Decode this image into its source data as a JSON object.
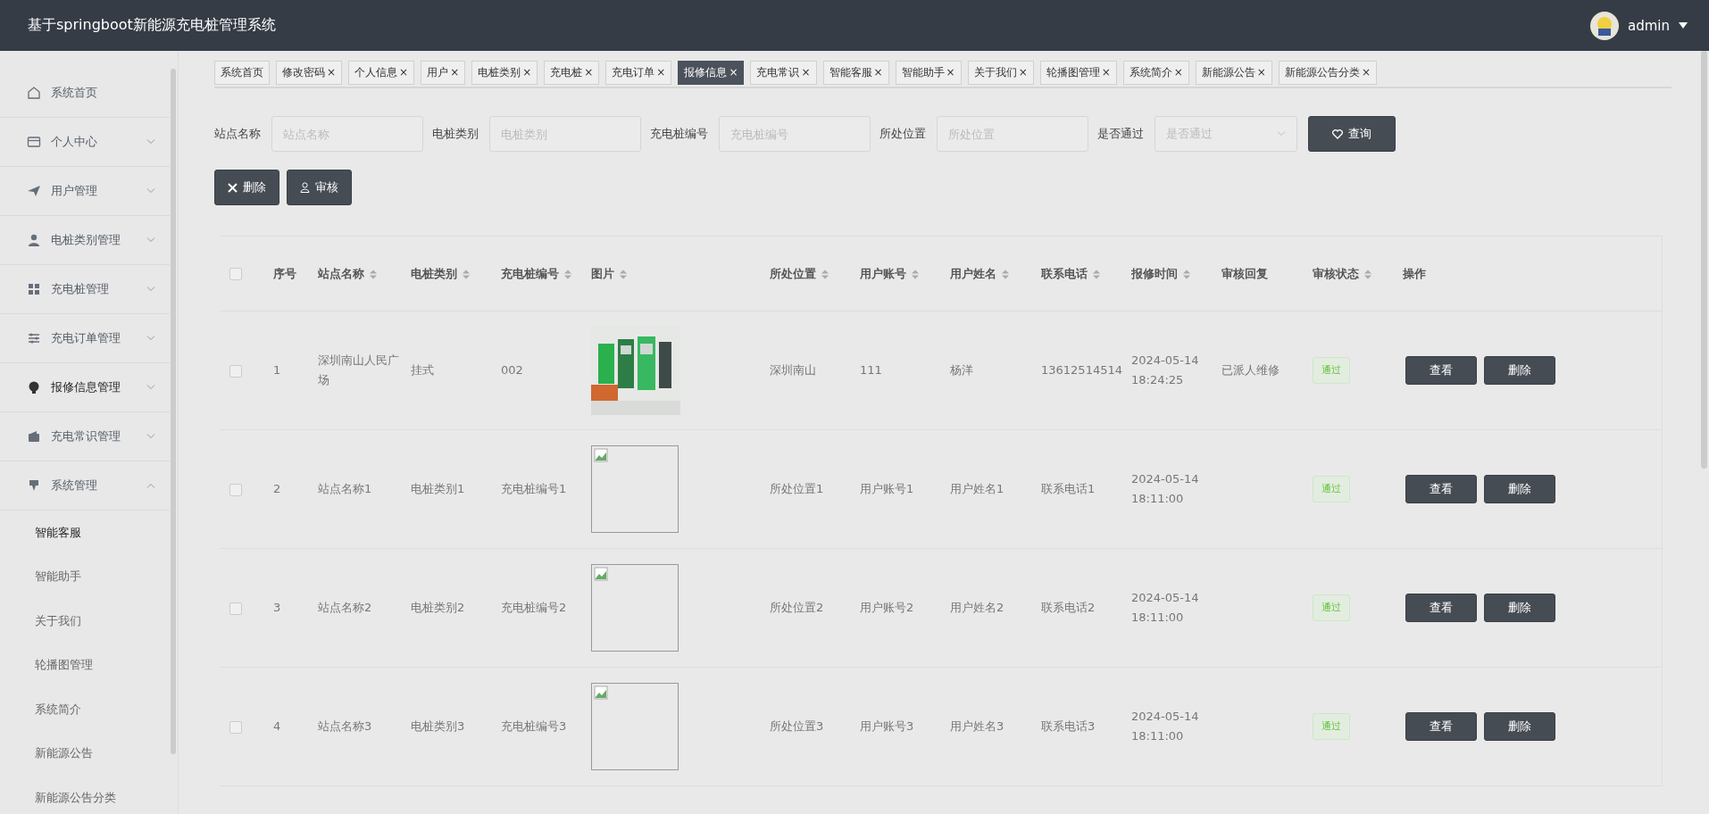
{
  "header": {
    "title": "基于springboot新能源充电桩管理系统",
    "user": "admin"
  },
  "sidebar": {
    "items": [
      {
        "label": "系统首页",
        "selected": false
      },
      {
        "label": "个人中心",
        "expanded": false,
        "selected": false
      },
      {
        "label": "用户管理",
        "expanded": false,
        "selected": false
      },
      {
        "label": "电桩类别管理",
        "expanded": false,
        "selected": false
      },
      {
        "label": "充电桩管理",
        "expanded": false,
        "selected": false
      },
      {
        "label": "充电订单管理",
        "expanded": false,
        "selected": false
      },
      {
        "label": "报修信息管理",
        "expanded": false,
        "selected": true
      },
      {
        "label": "充电常识管理",
        "expanded": false,
        "selected": false
      },
      {
        "label": "系统管理",
        "expanded": true,
        "selected": false,
        "children": [
          {
            "label": "智能客服",
            "selected": true
          },
          {
            "label": "智能助手",
            "selected": false
          },
          {
            "label": "关于我们",
            "selected": false
          },
          {
            "label": "轮播图管理",
            "selected": false
          },
          {
            "label": "系统简介",
            "selected": false
          },
          {
            "label": "新能源公告",
            "selected": false
          },
          {
            "label": "新能源公告分类",
            "selected": false
          }
        ]
      }
    ]
  },
  "tabs": [
    {
      "label": "系统首页",
      "selected": false
    },
    {
      "label": "修改密码",
      "close": "×",
      "selected": false
    },
    {
      "label": "个人信息",
      "close": "×",
      "selected": false
    },
    {
      "label": "用户",
      "close": "×",
      "selected": false
    },
    {
      "label": "电桩类别",
      "close": "×",
      "selected": false
    },
    {
      "label": "充电桩",
      "close": "×",
      "selected": false
    },
    {
      "label": "充电订单",
      "close": "×",
      "selected": false
    },
    {
      "label": "报修信息",
      "close": "×",
      "selected": true
    },
    {
      "label": "充电常识",
      "close": "×",
      "selected": false
    },
    {
      "label": "智能客服",
      "close": "×",
      "selected": false
    },
    {
      "label": "智能助手",
      "close": "×",
      "selected": false
    },
    {
      "label": "关于我们",
      "close": "×",
      "selected": false
    },
    {
      "label": "轮播图管理",
      "close": "×",
      "selected": false
    },
    {
      "label": "系统简介",
      "close": "×",
      "selected": false
    },
    {
      "label": "新能源公告",
      "close": "×",
      "selected": false
    },
    {
      "label": "新能源公告分类",
      "close": "×",
      "selected": false
    }
  ],
  "filters": [
    {
      "label": "站点名称",
      "placeholder": "站点名称",
      "kind": "input"
    },
    {
      "label": "电桩类别",
      "placeholder": "电桩类别",
      "kind": "input"
    },
    {
      "label": "充电桩编号",
      "placeholder": "充电桩编号",
      "kind": "input"
    },
    {
      "label": "所处位置",
      "placeholder": "所处位置",
      "kind": "input"
    },
    {
      "label": "是否通过",
      "placeholder": "是否通过",
      "kind": "select"
    }
  ],
  "search_button": "查询",
  "actions": [
    "删除",
    "审核"
  ],
  "table": {
    "all_checked": false,
    "columns": [
      {
        "label": "序号",
        "sortable": false
      },
      {
        "label": "站点名称",
        "sortable": true
      },
      {
        "label": "电桩类别",
        "sortable": true
      },
      {
        "label": "充电桩编号",
        "sortable": true
      },
      {
        "label": "图片",
        "sortable": true
      },
      {
        "label": "所处位置",
        "sortable": true
      },
      {
        "label": "用户账号",
        "sortable": true
      },
      {
        "label": "用户姓名",
        "sortable": true
      },
      {
        "label": "联系电话",
        "sortable": true
      },
      {
        "label": "报修时间",
        "sortable": true
      },
      {
        "label": "审核回复",
        "sortable": false
      },
      {
        "label": "审核状态",
        "sortable": true
      },
      {
        "label": "操作",
        "sortable": false
      }
    ],
    "rows": [
      {
        "checked": false,
        "cells": [
          "1",
          "深圳南山人民广场",
          "挂式",
          "002"
        ],
        "image": {
          "kind": "picture"
        },
        "cells2": [
          "深圳南山",
          "111",
          "杨洋",
          "13612514514",
          "2024-05-14 18:24:25",
          "已派人维修"
        ],
        "status": "通过",
        "buttons": [
          "查看",
          "删除"
        ]
      },
      {
        "checked": false,
        "cells": [
          "2",
          "站点名称1",
          "电桩类别1",
          "充电桩编号1"
        ],
        "image": {
          "kind": "broken"
        },
        "cells2": [
          "所处位置1",
          "用户账号1",
          "用户姓名1",
          "联系电话1",
          "2024-05-14 18:11:00"
        ],
        "status": "通过",
        "buttons": [
          "查看",
          "删除"
        ]
      },
      {
        "checked": false,
        "cells": [
          "3",
          "站点名称2",
          "电桩类别2",
          "充电桩编号2"
        ],
        "image": {
          "kind": "broken"
        },
        "cells2": [
          "所处位置2",
          "用户账号2",
          "用户姓名2",
          "联系电话2",
          "2024-05-14 18:11:00"
        ],
        "status": "通过",
        "buttons": [
          "查看",
          "删除"
        ]
      },
      {
        "checked": false,
        "cells": [
          "4",
          "站点名称3",
          "电桩类别3",
          "充电桩编号3"
        ],
        "image": {
          "kind": "broken"
        },
        "cells2": [
          "所处位置3",
          "用户账号3",
          "用户姓名3",
          "联系电话3",
          "2024-05-14 18:11:00"
        ],
        "status": "通过",
        "buttons": [
          "查看",
          "删除"
        ]
      }
    ]
  }
}
